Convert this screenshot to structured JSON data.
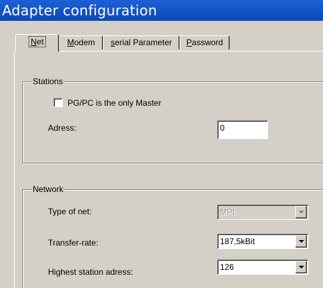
{
  "window": {
    "title": "Adapter configuration"
  },
  "tabs": [
    {
      "prefix": "",
      "accel": "N",
      "rest": "et",
      "active": true
    },
    {
      "prefix": "",
      "accel": "M",
      "rest": "odem",
      "active": false
    },
    {
      "prefix": "",
      "accel": "s",
      "rest": "erial Parameter",
      "active": false
    },
    {
      "prefix": "",
      "accel": "P",
      "rest": "assword",
      "active": false
    }
  ],
  "stations": {
    "legend": "Stations",
    "only_master_label": "PG/PC is the only Master",
    "only_master_checked": false,
    "address_label": "Adress:",
    "address_value": "0"
  },
  "network": {
    "legend": "Network",
    "type_label": "Type of net:",
    "type_value": "MPI",
    "rate_label": "Transfer-rate:",
    "rate_value": "187,5kBit",
    "highest_label": "Highest station adress:",
    "highest_value": "126"
  }
}
